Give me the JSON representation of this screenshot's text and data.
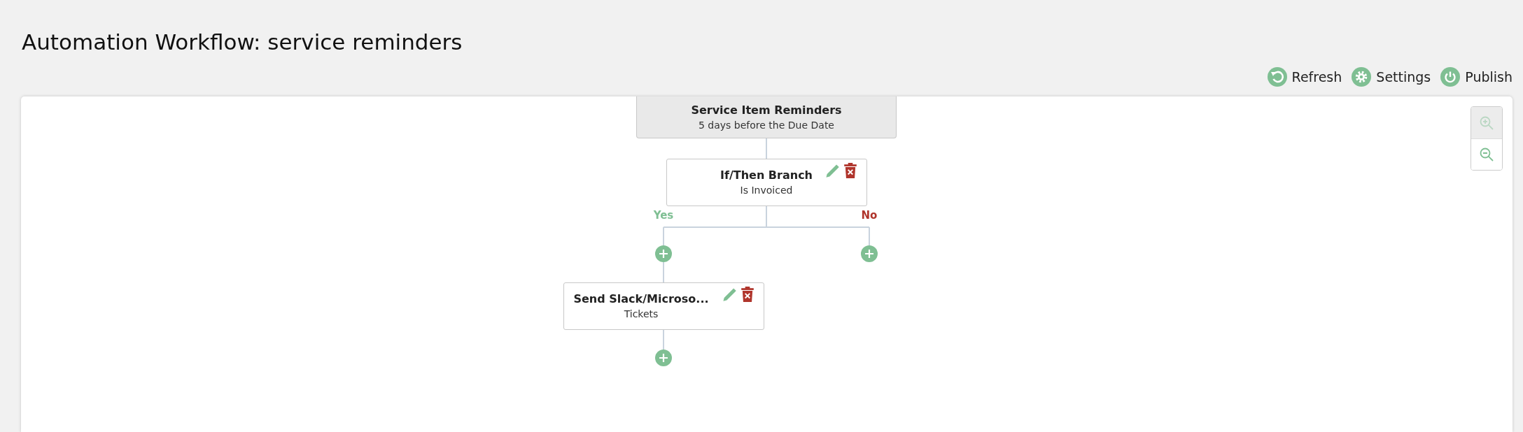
{
  "page_title": "Automation Workflow: service reminders",
  "toolbar": [
    {
      "kind": "refresh",
      "label": "Refresh"
    },
    {
      "kind": "settings",
      "label": "Settings"
    },
    {
      "kind": "publish",
      "label": "Publish"
    }
  ],
  "zoom_controls": [
    {
      "kind": "zoom-in",
      "disabled": true
    },
    {
      "kind": "zoom-out",
      "disabled": false
    }
  ],
  "workflow": {
    "trigger": {
      "title": "Service Item Reminders",
      "subtitle": "5 days before the Due Date"
    },
    "steps": [
      {
        "kind": "branch",
        "title": "If/Then Branch",
        "subtitle": "Is Invoiced",
        "branches": [
          {
            "kind": "yes",
            "label": "Yes",
            "steps": [
              {
                "kind": "action",
                "title": "Send Slack/Microso...",
                "subtitle": "Tickets"
              }
            ]
          },
          {
            "kind": "no",
            "label": "No"
          }
        ]
      }
    ]
  }
}
